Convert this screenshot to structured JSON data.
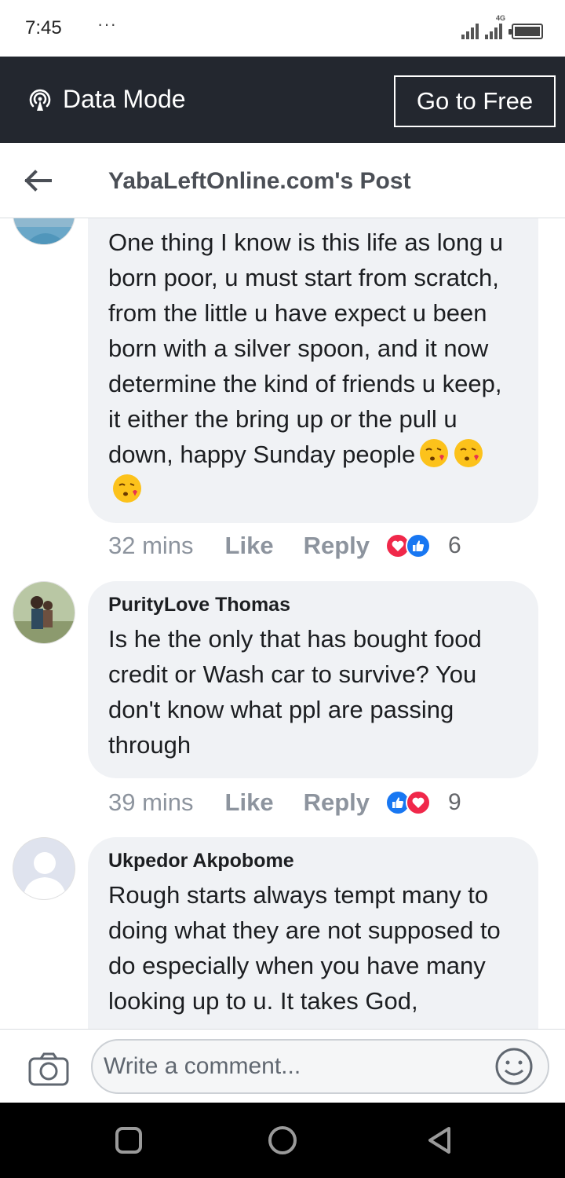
{
  "status": {
    "time": "7:45",
    "dots": "···",
    "network": "4G"
  },
  "databar": {
    "mode_label": "Data Mode",
    "go_free_label": "Go to Free"
  },
  "header": {
    "title": "YabaLeftOnline.com's Post"
  },
  "comments": [
    {
      "name": "",
      "text": "One thing I know is this life as long u born poor, u must start from scratch, from the little u have expect u been born with a silver spoon, and it now determine the kind of friends u keep, it either the bring up or the pull u down, happy Sunday people",
      "time": "32 mins",
      "like": "Like",
      "reply": "Reply",
      "reactions": [
        "love",
        "like"
      ],
      "reaction_count": "6"
    },
    {
      "name": "PurityLove Thomas",
      "text": "Is he the only that has bought food credit or Wash car to survive? You don't know what ppl are passing through",
      "time": "39 mins",
      "like": "Like",
      "reply": "Reply",
      "reactions": [
        "like",
        "love"
      ],
      "reaction_count": "9"
    },
    {
      "name": "Ukpedor Akpobome",
      "text": "Rough starts always tempt many to doing what they are not supposed to do especially when you have many looking up to u. It takes God,"
    }
  ],
  "composer": {
    "placeholder": "Write a comment..."
  },
  "colors": {
    "data_bar": "#23272f",
    "bubble": "#f0f2f5",
    "like_blue": "#1877f2",
    "love_red": "#f0284a",
    "muted_text": "#8d949e"
  },
  "icons": [
    "data-mode-icon",
    "back-arrow-icon",
    "love-reaction-icon",
    "like-reaction-icon",
    "kiss-emoji-icon",
    "camera-icon",
    "smiley-icon",
    "nav-recents-icon",
    "nav-home-icon",
    "nav-back-icon"
  ]
}
